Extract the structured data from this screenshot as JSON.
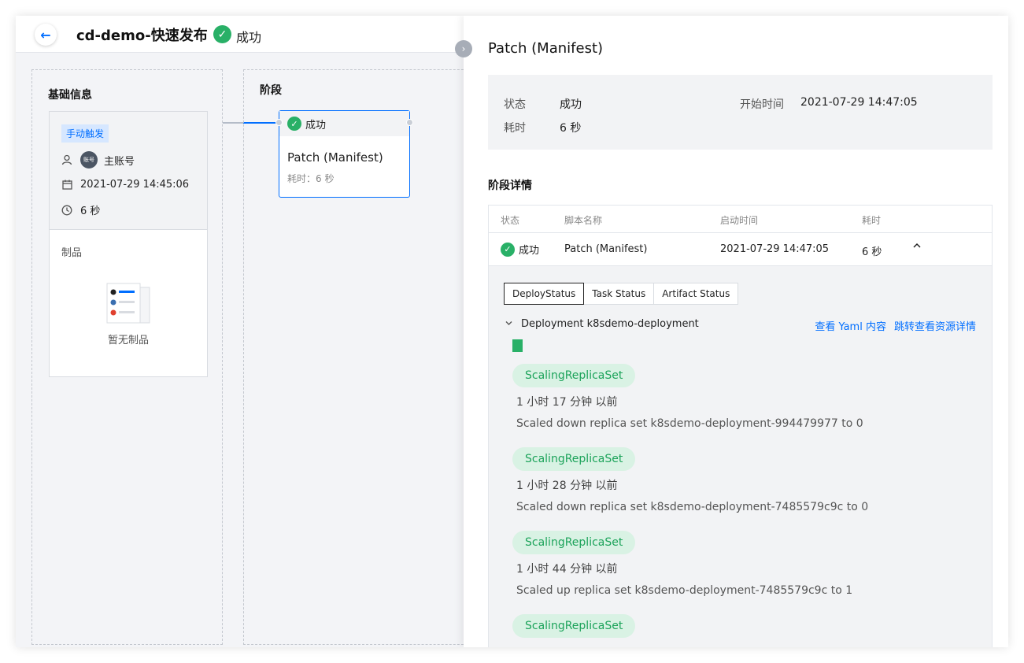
{
  "header": {
    "title": "cd-demo-快速发布",
    "status": "成功"
  },
  "basic_info": {
    "title": "基础信息",
    "trigger": "手动触发",
    "avatar_text": "账号",
    "user": "主账号",
    "date": "2021-07-29 14:45:06",
    "duration": "6 秒",
    "artifact_label": "制品",
    "empty_text": "暂无制品"
  },
  "stage_column": {
    "title": "阶段",
    "card": {
      "status": "成功",
      "name": "Patch (Manifest)",
      "duration": "耗时：6 秒"
    }
  },
  "panel": {
    "title": "Patch (Manifest)",
    "summary": {
      "status_label": "状态",
      "status_value": "成功",
      "duration_label": "耗时",
      "duration_value": "6 秒",
      "start_label": "开始时间",
      "start_value": "2021-07-29 14:47:05"
    },
    "section_title": "阶段详情",
    "table": {
      "headers": [
        "状态",
        "脚本名称",
        "启动时间",
        "耗时"
      ],
      "row": {
        "status": "成功",
        "script": "Patch (Manifest)",
        "start": "2021-07-29 14:47:05",
        "duration": "6 秒"
      }
    },
    "detail": {
      "tabs": [
        "DeployStatus",
        "Task Status",
        "Artifact Status"
      ],
      "deployment": "Deployment k8sdemo-deployment",
      "link_yaml": "查看 Yaml 内容",
      "link_resource": "跳转查看资源详情",
      "events": [
        {
          "tag": "ScalingReplicaSet",
          "time": "1 小时 17 分钟 以前",
          "message": "Scaled down replica set k8sdemo-deployment-994479977 to 0"
        },
        {
          "tag": "ScalingReplicaSet",
          "time": "1 小时 28 分钟 以前",
          "message": "Scaled down replica set k8sdemo-deployment-7485579c9c to 0"
        },
        {
          "tag": "ScalingReplicaSet",
          "time": "1 小时 44 分钟 以前",
          "message": "Scaled up replica set k8sdemo-deployment-7485579c9c to 1"
        },
        {
          "tag": "ScalingReplicaSet",
          "time": "",
          "message": ""
        }
      ]
    }
  },
  "colors": {
    "accent": "#006eff",
    "success": "#29b067"
  }
}
